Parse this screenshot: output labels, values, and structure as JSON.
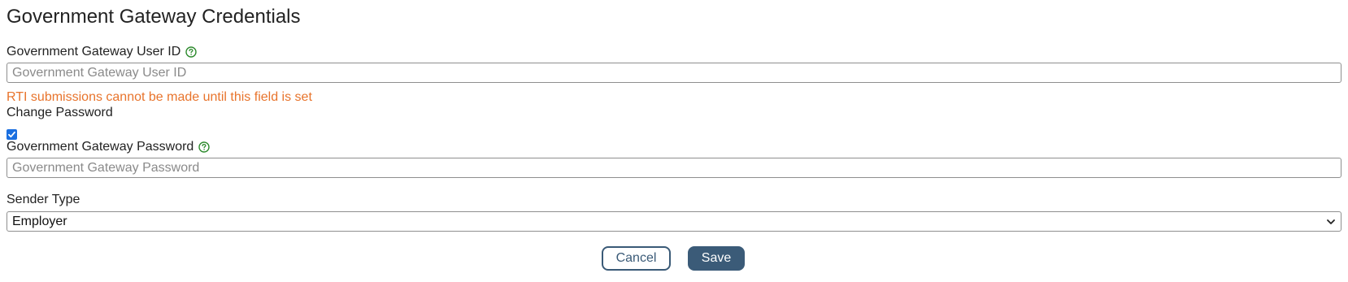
{
  "page": {
    "title": "Government Gateway Credentials"
  },
  "user_id": {
    "label": "Government Gateway User ID",
    "value": "",
    "placeholder": "Government Gateway User ID",
    "warning": "RTI submissions cannot be made until this field is set"
  },
  "change_password": {
    "label": "Change Password",
    "checked": true
  },
  "password": {
    "label": "Government Gateway Password",
    "value": "",
    "placeholder": "Government Gateway Password"
  },
  "sender_type": {
    "label": "Sender Type",
    "selected": "Employer"
  },
  "actions": {
    "cancel_label": "Cancel",
    "save_label": "Save"
  },
  "icons": {
    "help": "help-circle-icon",
    "check": "checkmark-icon",
    "dropdown": "chevron-down-icon"
  },
  "colors": {
    "help_icon": "#2e8b2e",
    "warning_text": "#e8742c",
    "checkbox_accent": "#1a6fe0",
    "primary_button": "#3b5b78"
  }
}
